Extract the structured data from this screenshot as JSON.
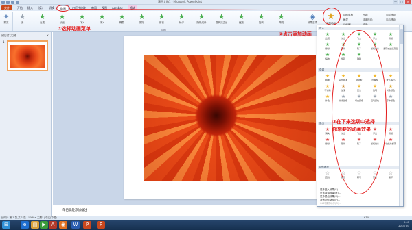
{
  "window": {
    "title": "演示文稿1 - Microsoft PowerPoint",
    "buttons": [
      "—",
      "□",
      "×"
    ]
  },
  "tabs": [
    {
      "label": "文件",
      "kind": "file"
    },
    {
      "label": "开始"
    },
    {
      "label": "插入"
    },
    {
      "label": "设计"
    },
    {
      "label": "切换"
    },
    {
      "label": "动画",
      "kind": "active"
    },
    {
      "label": "幻灯片放映"
    },
    {
      "label": "审阅"
    },
    {
      "label": "视图"
    },
    {
      "label": "Acrobat"
    },
    {
      "label": "格式",
      "kind": "picfmt"
    }
  ],
  "ribbon": {
    "preview_label": "预览",
    "animation_group_label": "动画",
    "effects": [
      {
        "label": "无",
        "color": "#9aa5b1"
      },
      {
        "label": "出现",
        "color": "#4caf50"
      },
      {
        "label": "淡出",
        "color": "#4caf50"
      },
      {
        "label": "飞入",
        "color": "#4caf50"
      },
      {
        "label": "浮入",
        "color": "#4caf50"
      },
      {
        "label": "劈裂",
        "color": "#4caf50"
      },
      {
        "label": "擦除",
        "color": "#4caf50"
      },
      {
        "label": "形状",
        "color": "#4caf50"
      },
      {
        "label": "轮子",
        "color": "#4caf50"
      },
      {
        "label": "随机线条",
        "color": "#4caf50"
      },
      {
        "label": "翻转式由远及近",
        "color": "#4caf50"
      },
      {
        "label": "缩放",
        "color": "#4caf50"
      },
      {
        "label": "旋转",
        "color": "#4caf50"
      },
      {
        "label": "弹跳",
        "color": "#4caf50"
      }
    ],
    "effect_options_label": "效果选项",
    "add_animation_label": "添加动画",
    "right_items": [
      "动画窗格",
      "触发",
      "动画刷"
    ],
    "timing_items": [
      "开始:",
      "持续时间:",
      "延迟:"
    ],
    "reorder_items": [
      "向前移动",
      "向后移动"
    ]
  },
  "left_panel": {
    "tabs_label": "幻灯片  大纲",
    "close": "×",
    "slide_number": "1"
  },
  "notes": {
    "text": "单击此处添加备注"
  },
  "dropdown": {
    "sections": [
      {
        "title": "进入",
        "items": [
          {
            "label": "出现",
            "color": "#4caf50"
          },
          {
            "label": "淡出",
            "color": "#4caf50"
          },
          {
            "label": "飞入",
            "color": "#4caf50"
          },
          {
            "label": "浮入",
            "color": "#4caf50"
          },
          {
            "label": "劈裂",
            "color": "#4caf50"
          },
          {
            "label": "擦除",
            "color": "#4caf50"
          },
          {
            "label": "形状",
            "color": "#4caf50"
          },
          {
            "label": "轮子",
            "color": "#4caf50"
          },
          {
            "label": "随机线条",
            "color": "#4caf50"
          },
          {
            "label": "翻转式由远及近",
            "color": "#4caf50"
          },
          {
            "label": "缩放",
            "color": "#4caf50"
          },
          {
            "label": "旋转",
            "color": "#4caf50"
          },
          {
            "label": "弹跳",
            "color": "#4caf50"
          }
        ]
      },
      {
        "title": "强调",
        "items": [
          {
            "label": "脉冲",
            "color": "#f2b92f"
          },
          {
            "label": "彩色脉冲",
            "color": "#f2b92f"
          },
          {
            "label": "跷跷板",
            "color": "#f2b92f"
          },
          {
            "label": "陀螺旋",
            "color": "#f2b92f"
          },
          {
            "label": "放大/缩小",
            "color": "#f2b92f"
          },
          {
            "label": "不饱和",
            "color": "#f2b92f"
          },
          {
            "label": "加深",
            "color": "#c8872a"
          },
          {
            "label": "变淡",
            "color": "#f2b92f"
          },
          {
            "label": "透明",
            "color": "#f2b92f"
          },
          {
            "label": "对象颜色",
            "color": "#d9a326"
          },
          {
            "label": "补色",
            "color": "#f2b92f"
          },
          {
            "label": "线条颜色",
            "color": "#9aa5b1"
          },
          {
            "label": "填充颜色",
            "color": "#9aa5b1"
          },
          {
            "label": "画笔颜色",
            "color": "#9aa5b1"
          },
          {
            "label": "字体颜色",
            "color": "#9aa5b1"
          }
        ]
      },
      {
        "title": "退出",
        "items": [
          {
            "label": "消失",
            "color": "#e04848"
          },
          {
            "label": "淡出",
            "color": "#e04848"
          },
          {
            "label": "飞出",
            "color": "#e04848"
          },
          {
            "label": "浮出",
            "color": "#e04848"
          },
          {
            "label": "劈裂",
            "color": "#e04848"
          },
          {
            "label": "擦除",
            "color": "#e04848"
          },
          {
            "label": "形状",
            "color": "#e04848"
          },
          {
            "label": "轮子",
            "color": "#e04848"
          },
          {
            "label": "随机线条",
            "color": "#e04848"
          },
          {
            "label": "收缩并旋转",
            "color": "#e04848"
          }
        ]
      },
      {
        "title": "动作路径",
        "items": [
          {
            "label": "直线",
            "color": "#777777"
          },
          {
            "label": "弧形",
            "color": "#777777"
          },
          {
            "label": "转弯",
            "color": "#777777"
          },
          {
            "label": "形状",
            "color": "#777777"
          },
          {
            "label": "循环",
            "color": "#777777"
          }
        ]
      }
    ],
    "links": [
      {
        "label": "更多进入效果(E)...",
        "enabled": true
      },
      {
        "label": "更多强调效果(M)...",
        "enabled": true
      },
      {
        "label": "更多退出效果(X)...",
        "enabled": true
      },
      {
        "label": "其他动作路径(P)...",
        "enabled": true
      },
      {
        "label": "OLE 操作动作(O)...",
        "enabled": false
      }
    ]
  },
  "statusbar": {
    "left": "幻灯片 第 1 张,共 1 张 | \"Office 主题\" | 中文(中国)",
    "zoom": "67%"
  },
  "taskbar": {
    "icons": [
      {
        "glyph": "⊞",
        "color": "#2f8fd6"
      },
      {
        "glyph": "e",
        "color": "#1f6fd0"
      },
      {
        "glyph": "▤",
        "color": "#d9a03a"
      },
      {
        "glyph": "▶",
        "color": "#3a9a3a"
      },
      {
        "glyph": "A",
        "color": "#b23a2a"
      },
      {
        "glyph": "◉",
        "color": "#e07020"
      },
      {
        "glyph": "W",
        "color": "#2a5db0"
      },
      {
        "glyph": "P",
        "color": "#c8471e"
      },
      {
        "glyph": "P",
        "color": "#c8471e"
      }
    ],
    "time": "9:07",
    "date": "2014/7/3"
  },
  "annotations": {
    "step1": "①选择动画菜单",
    "step2": "②点击添加动画",
    "step3_line1": "③在下来选项中选择",
    "step3_line2": "你想要的动画效果"
  }
}
